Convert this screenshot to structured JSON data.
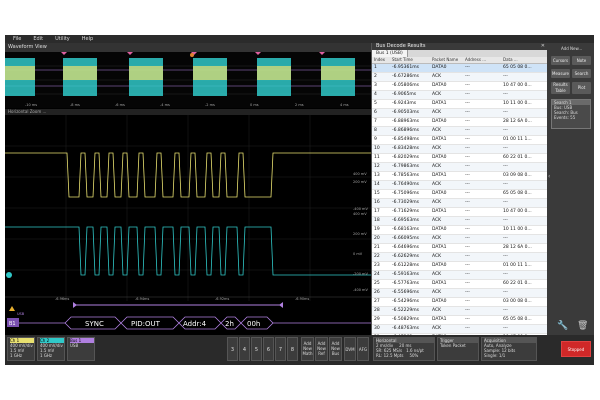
{
  "menu": [
    "File",
    "Edit",
    "Utility",
    "Help"
  ],
  "waveform_view": {
    "title": "Waveform View",
    "zoom_label": "Horizontal Zoom ...",
    "overview_ticks": [
      "-10 ms",
      "-8 ms",
      "-6 ms",
      "-4 ms",
      "-2 ms",
      "0 ms",
      "2 ms",
      "4 ms"
    ],
    "ch1_scale": [
      "400 mV",
      "200 mV",
      "-400 mV"
    ],
    "ch2_scale": [
      "400 mV",
      "200 mV",
      "0 mV",
      "-200 mV",
      "-400 mV"
    ],
    "zoom_ticks": [
      "-6.96ms",
      "-6.94ms",
      "-6.92ms",
      "-6.90ms"
    ]
  },
  "bus": {
    "label": "B1",
    "type": "USB",
    "fields": [
      "SYNC",
      "PID:OUT",
      "Addr:4",
      "2h",
      "00h"
    ]
  },
  "results": {
    "title": "Bus Decode Results",
    "tab": "Bus 1 (USB)",
    "columns": [
      "Index",
      "Start Time",
      "Packet Name",
      "Address ...",
      "Data ..."
    ],
    "rows": [
      {
        "i": "1",
        "t": "-6.95361ms",
        "p": "DATA0",
        "a": "---",
        "d": "65 05 08 0..."
      },
      {
        "i": "2",
        "t": "-6.67286ms",
        "p": "ACK",
        "a": "---",
        "d": "---"
      },
      {
        "i": "3",
        "t": "-6.05806ms",
        "p": "DATA0",
        "a": "---",
        "d": "10 47 00 0..."
      },
      {
        "i": "4",
        "t": "-6.9065ms",
        "p": "ACK",
        "a": "---",
        "d": "---"
      },
      {
        "i": "5",
        "t": "-6.9243ms",
        "p": "DATA1",
        "a": "---",
        "d": "10 11 00 0..."
      },
      {
        "i": "6",
        "t": "-6.90503ms",
        "p": "ACK",
        "a": "---",
        "d": "---"
      },
      {
        "i": "7",
        "t": "-6.88963ms",
        "p": "DATA0",
        "a": "---",
        "d": "28 12 6A 0..."
      },
      {
        "i": "8",
        "t": "-6.86896ms",
        "p": "ACK",
        "a": "---",
        "d": "---"
      },
      {
        "i": "9",
        "t": "-6.85498ms",
        "p": "DATA1",
        "a": "---",
        "d": "01 00 11 1..."
      },
      {
        "i": "10",
        "t": "-6.83428ms",
        "p": "ACK",
        "a": "---",
        "d": "---"
      },
      {
        "i": "11",
        "t": "-6.82029ms",
        "p": "DATA0",
        "a": "---",
        "d": "60 22 01 0..."
      },
      {
        "i": "12",
        "t": "-6.79863ms",
        "p": "ACK",
        "a": "---",
        "d": "---"
      },
      {
        "i": "13",
        "t": "-6.78563ms",
        "p": "DATA1",
        "a": "---",
        "d": "03 09 08 0..."
      },
      {
        "i": "14",
        "t": "-6.76490ms",
        "p": "ACK",
        "a": "---",
        "d": "---"
      },
      {
        "i": "15",
        "t": "-6.75096ms",
        "p": "DATA0",
        "a": "---",
        "d": "65 05 08 0..."
      },
      {
        "i": "16",
        "t": "-6.73029ms",
        "p": "ACK",
        "a": "---",
        "d": "---"
      },
      {
        "i": "17",
        "t": "-6.71629ms",
        "p": "DATA1",
        "a": "---",
        "d": "10 47 00 0..."
      },
      {
        "i": "18",
        "t": "-6.69563ms",
        "p": "ACK",
        "a": "---",
        "d": "---"
      },
      {
        "i": "19",
        "t": "-6.68163ms",
        "p": "DATA0",
        "a": "---",
        "d": "10 11 00 0..."
      },
      {
        "i": "20",
        "t": "-6.66095ms",
        "p": "ACK",
        "a": "---",
        "d": "---"
      },
      {
        "i": "21",
        "t": "-6.64696ms",
        "p": "DATA1",
        "a": "---",
        "d": "28 12 6A 0..."
      },
      {
        "i": "22",
        "t": "-6.62629ms",
        "p": "ACK",
        "a": "---",
        "d": "---"
      },
      {
        "i": "23",
        "t": "-6.61228ms",
        "p": "DATA0",
        "a": "---",
        "d": "01 00 11 1..."
      },
      {
        "i": "24",
        "t": "-6.59163ms",
        "p": "ACK",
        "a": "---",
        "d": "---"
      },
      {
        "i": "25",
        "t": "-6.57763ms",
        "p": "DATA1",
        "a": "---",
        "d": "60 22 01 0..."
      },
      {
        "i": "26",
        "t": "-6.55696ms",
        "p": "ACK",
        "a": "---",
        "d": "---"
      },
      {
        "i": "27",
        "t": "-6.54296ms",
        "p": "DATA0",
        "a": "---",
        "d": "03 00 08 0..."
      },
      {
        "i": "28",
        "t": "-6.52229ms",
        "p": "ACK",
        "a": "---",
        "d": "---"
      },
      {
        "i": "29",
        "t": "-6.50829ms",
        "p": "DATA1",
        "a": "---",
        "d": "65 05 08 0..."
      },
      {
        "i": "30",
        "t": "-6.48763ms",
        "p": "ACK",
        "a": "---",
        "d": "---"
      },
      {
        "i": "31",
        "t": "-6.47363ms",
        "p": "DATA0",
        "a": "---",
        "d": "10 47 00 0..."
      }
    ]
  },
  "right_panel": {
    "add_new": "Add New...",
    "buttons": [
      "Cursors",
      "Note",
      "Measure",
      "Search",
      "Results Table",
      "Plot"
    ],
    "search_title": "Search 1",
    "search_lines": [
      "Bus: USB",
      "Search: Bus",
      "Events: 55"
    ]
  },
  "bottom": {
    "ch1": {
      "label": "Ch 1",
      "lines": [
        "400 mV/div",
        "1.5 mV",
        "1 GHz"
      ]
    },
    "ch2": {
      "label": "Ch 2",
      "lines": [
        "400 mV/div",
        "1.5 mV",
        "1 GHz"
      ]
    },
    "bus1": {
      "label": "Bus 1",
      "lines": [
        "USB"
      ]
    },
    "channel_buttons": [
      "3",
      "4",
      "5",
      "6",
      "7",
      "8"
    ],
    "add_buttons": [
      "Add New Math",
      "Add New Ref",
      "Add New Bus"
    ],
    "dvm": "DVM",
    "afg": "AFG",
    "horizontal": {
      "label": "Horizontal",
      "lines": [
        "2 ms/div",
        "20 ms",
        "SR: 625 MS/s",
        "1.6 ns/pt",
        "RL: 12.5 Mpts",
        "50%"
      ]
    },
    "trigger": {
      "label": "Trigger",
      "lines": [
        "Token Packet"
      ]
    },
    "acquisition": {
      "label": "Acquisition",
      "lines": [
        "Auto,  Analyze",
        "Sample: 12 bits",
        "Single: 1/1"
      ]
    },
    "stop": "Stopped"
  },
  "colors": {
    "ch1": "#e8e070",
    "ch2": "#30c8c8",
    "bus": "#b080e0",
    "accent": "#e02828"
  }
}
